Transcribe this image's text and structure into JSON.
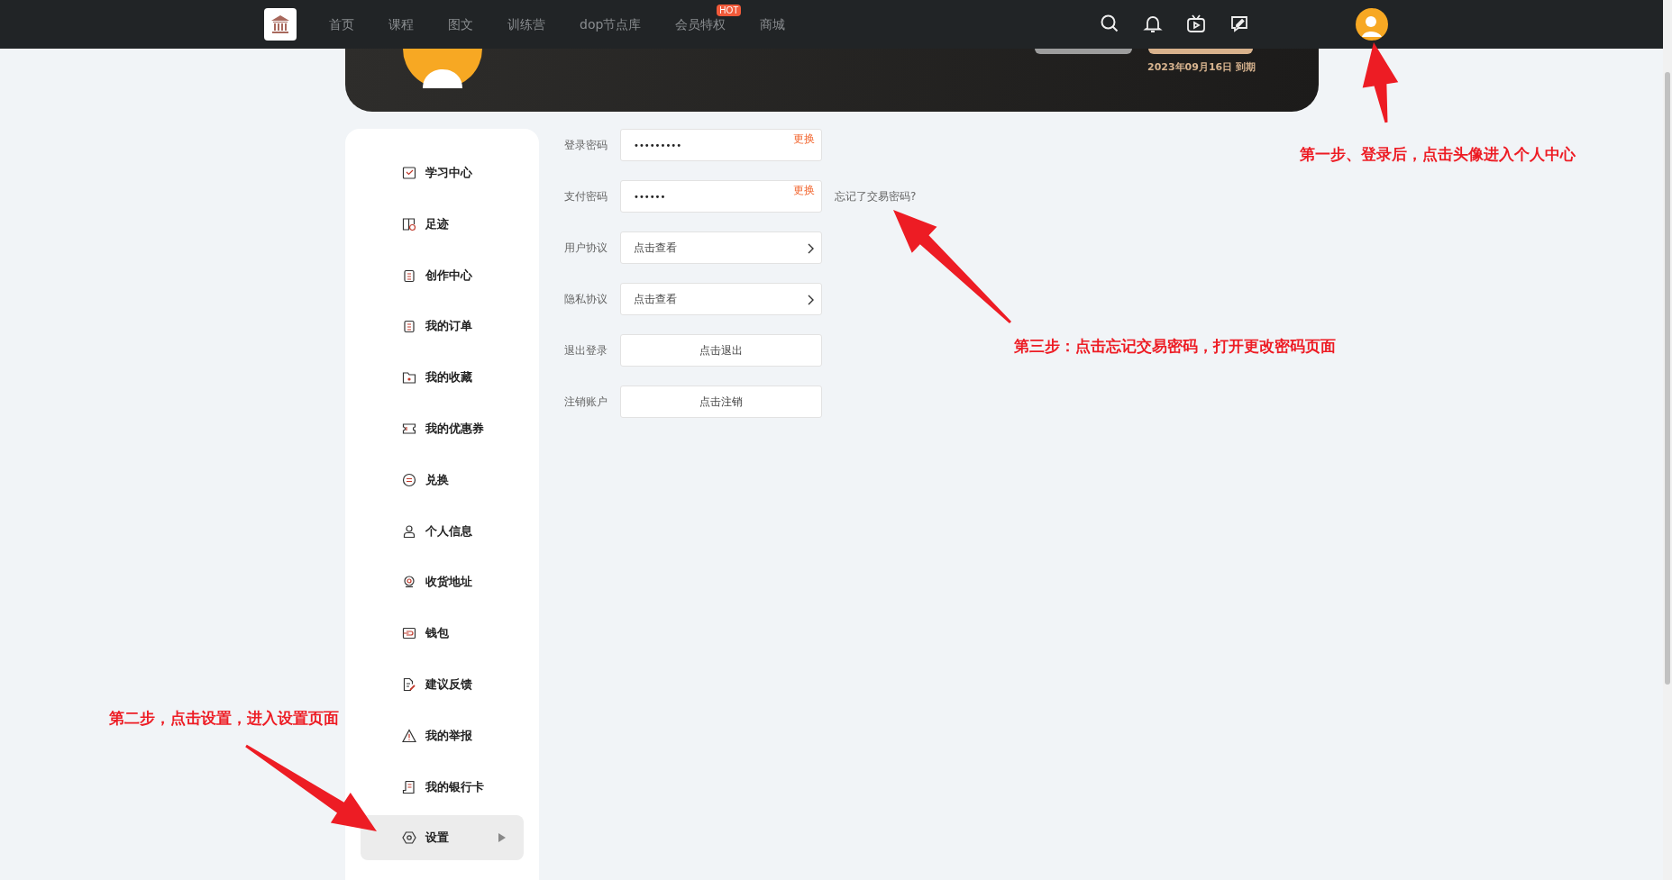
{
  "nav": {
    "items": [
      {
        "label": "首页"
      },
      {
        "label": "课程"
      },
      {
        "label": "图文"
      },
      {
        "label": "训练营"
      },
      {
        "label": "dop节点库"
      },
      {
        "label": "会员特权",
        "badge": "HOT"
      },
      {
        "label": "商城"
      }
    ]
  },
  "banner": {
    "expiry": "2023年09月16日 到期"
  },
  "sidebar": {
    "items": [
      {
        "label": "学习中心",
        "selected": false
      },
      {
        "label": "足迹",
        "selected": false
      },
      {
        "label": "创作中心",
        "selected": false
      },
      {
        "label": "我的订单",
        "selected": false
      },
      {
        "label": "我的收藏",
        "selected": false
      },
      {
        "label": "我的优惠券",
        "selected": false
      },
      {
        "label": "兑换",
        "selected": false
      },
      {
        "label": "个人信息",
        "selected": false
      },
      {
        "label": "收货地址",
        "selected": false
      },
      {
        "label": "钱包",
        "selected": false
      },
      {
        "label": "建议反馈",
        "selected": false
      },
      {
        "label": "我的举报",
        "selected": false
      },
      {
        "label": "我的银行卡",
        "selected": false
      },
      {
        "label": "设置",
        "selected": true
      }
    ]
  },
  "settings": {
    "rows": [
      {
        "kind": "password",
        "label": "登录密码",
        "value": "•••••••••",
        "action": "更换"
      },
      {
        "kind": "password",
        "label": "支付密码",
        "value": "••••••",
        "action": "更换",
        "extra_link": "忘记了交易密码?"
      },
      {
        "kind": "link",
        "label": "用户协议",
        "value": "点击查看"
      },
      {
        "kind": "link",
        "label": "隐私协议",
        "value": "点击查看"
      },
      {
        "kind": "button",
        "label": "退出登录",
        "value": "点击退出"
      },
      {
        "kind": "button",
        "label": "注销账户",
        "value": "点击注销"
      }
    ]
  },
  "annotations": [
    {
      "text": "第一步、登录后，点击头像进入个人中心"
    },
    {
      "text": "第二步，点击设置，进入设置页面"
    },
    {
      "text": "第三步：点击忘记交易密码，打开更改密码页面"
    }
  ]
}
